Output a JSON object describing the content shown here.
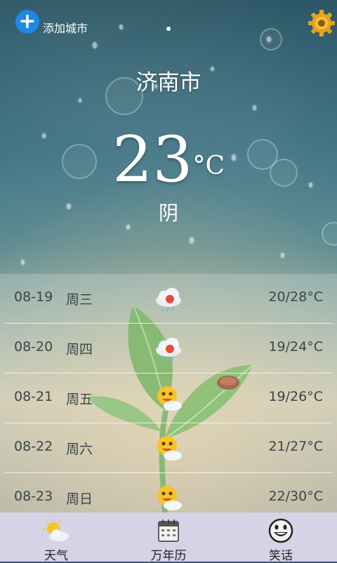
{
  "header": {
    "add_city_label": "添加城市",
    "settings_icon": "gear-icon"
  },
  "current": {
    "city": "济南市",
    "temperature": "23",
    "unit": "°C",
    "condition": "阴"
  },
  "forecast": [
    {
      "date": "08-19",
      "weekday": "周三",
      "icon": "cloud-rain-icon",
      "range": "20/28°C"
    },
    {
      "date": "08-20",
      "weekday": "周四",
      "icon": "cloud-rain-icon",
      "range": "19/24°C"
    },
    {
      "date": "08-21",
      "weekday": "周五",
      "icon": "sun-cloud-icon",
      "range": "19/26°C"
    },
    {
      "date": "08-22",
      "weekday": "周六",
      "icon": "sun-cloud-icon",
      "range": "21/27°C"
    },
    {
      "date": "08-23",
      "weekday": "周日",
      "icon": "sun-cloud-icon",
      "range": "22/30°C"
    }
  ],
  "tabs": [
    {
      "label": "天气",
      "icon": "weather-icon"
    },
    {
      "label": "万年历",
      "icon": "calendar-icon"
    },
    {
      "label": "笑话",
      "icon": "smiley-icon"
    }
  ]
}
